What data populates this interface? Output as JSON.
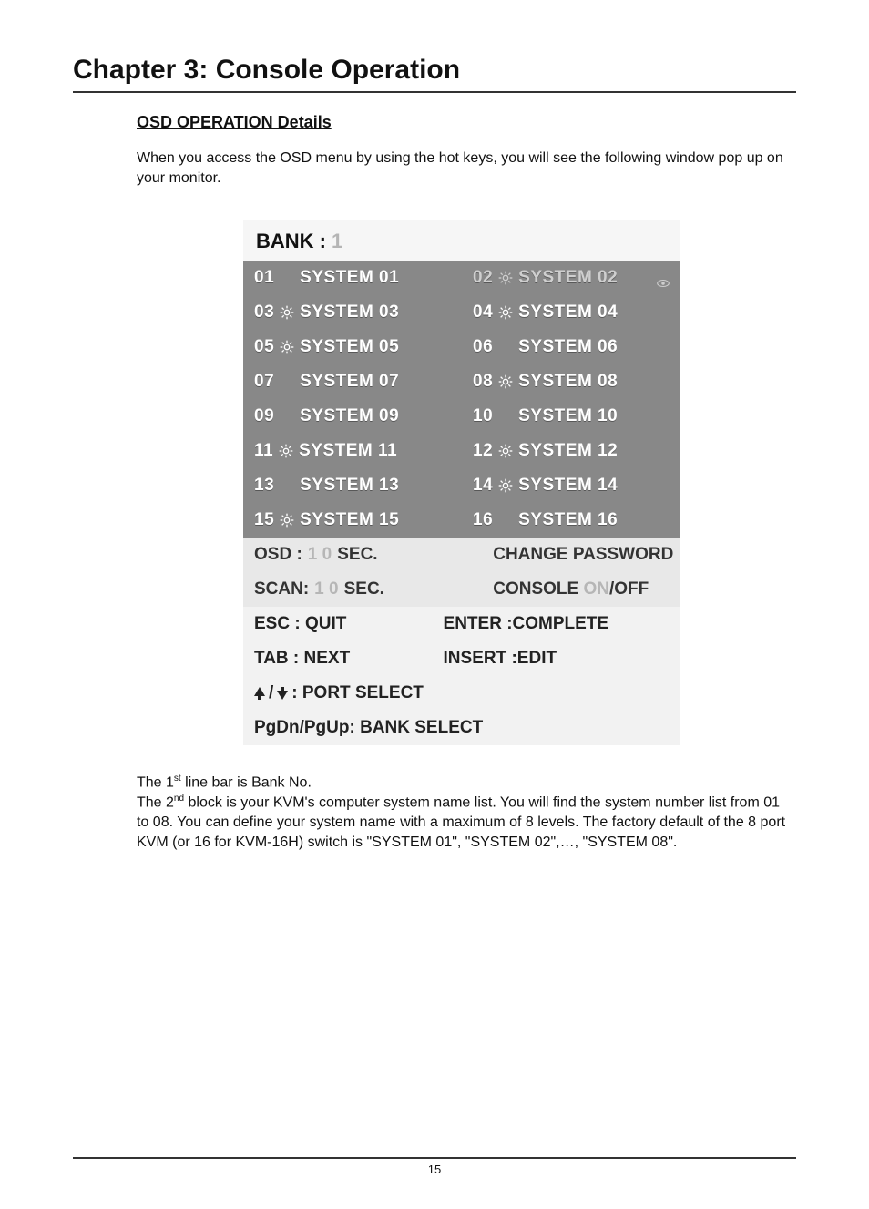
{
  "chapter_title": "Chapter 3: Console Operation",
  "section_heading": "OSD OPERATION Details",
  "intro_paragraph": "When you access the OSD menu by using the hot keys, you will see the following window pop up on your monitor.",
  "osd": {
    "bank_label": "BANK :",
    "bank_number": "1",
    "systems": [
      {
        "id": "01",
        "name": "SYSTEM 01",
        "sun": false,
        "selected": false
      },
      {
        "id": "02",
        "name": "SYSTEM 02",
        "sun": true,
        "selected": true
      },
      {
        "id": "03",
        "name": "SYSTEM 03",
        "sun": true,
        "selected": false
      },
      {
        "id": "04",
        "name": "SYSTEM 04",
        "sun": true,
        "selected": false
      },
      {
        "id": "05",
        "name": "SYSTEM 05",
        "sun": true,
        "selected": false
      },
      {
        "id": "06",
        "name": "SYSTEM 06",
        "sun": false,
        "selected": false
      },
      {
        "id": "07",
        "name": "SYSTEM 07",
        "sun": false,
        "selected": false
      },
      {
        "id": "08",
        "name": "SYSTEM 08",
        "sun": true,
        "selected": false
      },
      {
        "id": "09",
        "name": "SYSTEM 09",
        "sun": false,
        "selected": false
      },
      {
        "id": "10",
        "name": "SYSTEM 10",
        "sun": false,
        "selected": false
      },
      {
        "id": "11",
        "name": "SYSTEM 11",
        "sun": true,
        "selected": false
      },
      {
        "id": "12",
        "name": "SYSTEM 12",
        "sun": true,
        "selected": false
      },
      {
        "id": "13",
        "name": "SYSTEM 13",
        "sun": false,
        "selected": false
      },
      {
        "id": "14",
        "name": "SYSTEM 14",
        "sun": true,
        "selected": false
      },
      {
        "id": "15",
        "name": "SYSTEM 15",
        "sun": true,
        "selected": false
      },
      {
        "id": "16",
        "name": "SYSTEM 16",
        "sun": false,
        "selected": false
      }
    ],
    "mid": {
      "osd_prefix": "OSD :",
      "osd_d1": "1",
      "osd_d0": "0",
      "osd_suffix": "SEC.",
      "change_password": "CHANGE PASSWORD",
      "scan_prefix": "SCAN:",
      "scan_d1": "1",
      "scan_d0": "0",
      "scan_suffix": "SEC.",
      "console_prefix": "CONSOLE",
      "console_on": "ON",
      "console_off_suffix": "/OFF"
    },
    "help": {
      "esc": "ESC : QUIT",
      "enter": "ENTER :COMPLETE",
      "tab": "TAB : NEXT",
      "insert": "INSERT :EDIT",
      "port_select_suffix": ": PORT SELECT",
      "bank_select": "PgDn/PgUp: BANK  SELECT"
    }
  },
  "body": {
    "p1_pre": "The 1",
    "p1_sup": "st",
    "p1_post": " line bar is Bank No.",
    "p2_pre": "The 2",
    "p2_sup": "nd",
    "p2_post": " block is your KVM's computer system name list. You will find the system number list from 01 to 08. You can define your system name with a maximum of 8 levels. The factory default of the 8 port KVM (or 16 for KVM-16H) switch is \"SYSTEM 01\", \"SYSTEM 02\",…, \"SYSTEM 08\"."
  },
  "page_number": "15"
}
